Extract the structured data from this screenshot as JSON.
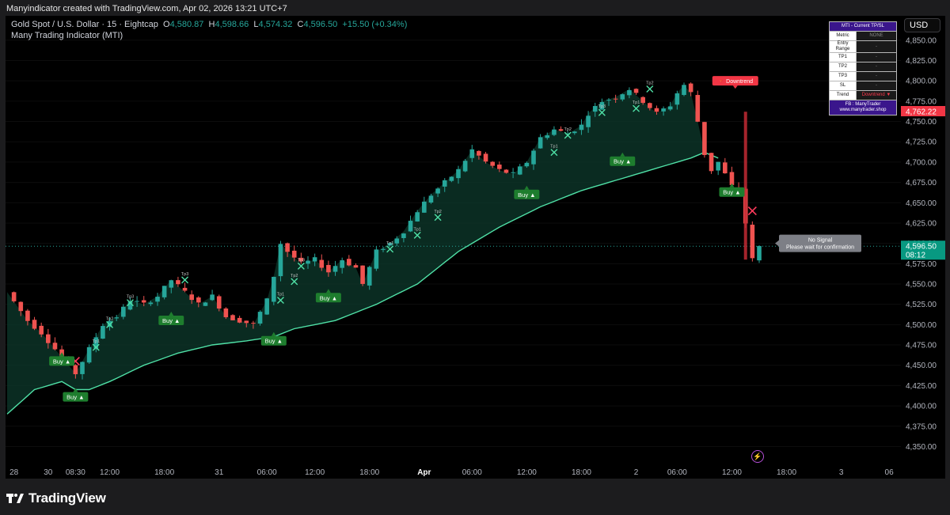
{
  "credit": "Manyindicator created with TradingView.com, Apr 02, 2026 13:21 UTC+7",
  "symbol": "Gold Spot / U.S. Dollar · 15 · Eightcap",
  "ohlc": {
    "o_label": "O",
    "o": "4,580.87",
    "h_label": "H",
    "h": "4,598.66",
    "l_label": "L",
    "l": "4,574.32",
    "c_label": "C",
    "c": "4,596.50",
    "change": "+15.50 (+0.34%)"
  },
  "indicator_name": "Many Trading Indicator (MTI)",
  "currency": "USD",
  "logo_text": "TradingView",
  "colors": {
    "bull": "#26a69a",
    "bear": "#ef5350",
    "ma": "#4fe0a6",
    "buy_bg": "#1e7d2e",
    "sell_red": "#f23645",
    "table_hdr": "#3a168c"
  },
  "mti_table": {
    "title": "MTI - Current TP/SL",
    "rows": [
      {
        "label": "Metric",
        "value": "NONE"
      },
      {
        "label": "Entry Range",
        "value": "-"
      },
      {
        "label": "TP1",
        "value": "-"
      },
      {
        "label": "TP2",
        "value": "-"
      },
      {
        "label": "TP3",
        "value": "-"
      },
      {
        "label": "SL",
        "value": "-"
      },
      {
        "label": "Trend",
        "value": "Downtrend ▼"
      }
    ],
    "footer_line1": "FB : ManyTrader",
    "footer_line2": "www.manytrader.shop"
  },
  "signals": {
    "buy_label": "Buy ▲",
    "downtrend_label": "🔻 Downtrend",
    "no_signal_line1": "No Signal",
    "no_signal_line2": "Please wait for confirmation"
  },
  "chart_data": {
    "type": "candlestick",
    "symbol": "XAUUSD",
    "timeframe": "15",
    "ylim": [
      4330,
      4880
    ],
    "y_ticks": [
      "4,350.00",
      "4,375.00",
      "4,400.00",
      "4,425.00",
      "4,450.00",
      "4,475.00",
      "4,500.00",
      "4,525.00",
      "4,550.00",
      "4,575.00",
      "4,600.00",
      "4,625.00",
      "4,650.00",
      "4,675.00",
      "4,700.00",
      "4,725.00",
      "4,750.00",
      "4,775.00",
      "4,800.00",
      "4,825.00",
      "4,850.00"
    ],
    "y_tick_values": [
      4350,
      4375,
      4400,
      4425,
      4450,
      4475,
      4500,
      4525,
      4550,
      4575,
      4600,
      4625,
      4650,
      4675,
      4700,
      4725,
      4750,
      4775,
      4800,
      4825,
      4850
    ],
    "x_ticks": [
      "28",
      "30",
      "08:30",
      "12:00",
      "18:00",
      "31",
      "06:00",
      "12:00",
      "18:00",
      "Apr",
      "06:00",
      "12:00",
      "18:00",
      "2",
      "06:00",
      "12:00",
      "18:00",
      "3",
      "06"
    ],
    "x_tick_index": [
      1,
      6,
      10,
      15,
      23,
      31,
      38,
      45,
      53,
      61,
      68,
      76,
      84,
      92,
      98,
      106,
      114,
      122,
      129
    ],
    "price_tags": [
      {
        "value": 4762.22,
        "label": "4,762.22",
        "color": "#f23645"
      },
      {
        "value": 4596.5,
        "label": "4,596.50",
        "sub": "08:12",
        "color": "#089981"
      }
    ],
    "last_price": 4596.5,
    "close_path": [
      [
        0,
        4540
      ],
      [
        3,
        4505
      ],
      [
        5,
        4490
      ],
      [
        7,
        4470
      ],
      [
        9,
        4450
      ],
      [
        10,
        4440
      ],
      [
        12,
        4470
      ],
      [
        14,
        4500
      ],
      [
        16,
        4510
      ],
      [
        18,
        4530
      ],
      [
        20,
        4525
      ],
      [
        22,
        4535
      ],
      [
        24,
        4555
      ],
      [
        26,
        4540
      ],
      [
        28,
        4525
      ],
      [
        30,
        4535
      ],
      [
        32,
        4510
      ],
      [
        34,
        4505
      ],
      [
        36,
        4500
      ],
      [
        38,
        4530
      ],
      [
        39,
        4560
      ],
      [
        40,
        4600
      ],
      [
        41,
        4590
      ],
      [
        43,
        4575
      ],
      [
        45,
        4580
      ],
      [
        47,
        4565
      ],
      [
        49,
        4580
      ],
      [
        51,
        4570
      ],
      [
        52,
        4550
      ],
      [
        54,
        4590
      ],
      [
        56,
        4600
      ],
      [
        58,
        4615
      ],
      [
        60,
        4640
      ],
      [
        62,
        4660
      ],
      [
        64,
        4675
      ],
      [
        66,
        4690
      ],
      [
        68,
        4715
      ],
      [
        70,
        4700
      ],
      [
        72,
        4690
      ],
      [
        74,
        4685
      ],
      [
        76,
        4700
      ],
      [
        78,
        4730
      ],
      [
        80,
        4740
      ],
      [
        82,
        4735
      ],
      [
        84,
        4745
      ],
      [
        85,
        4760
      ],
      [
        87,
        4775
      ],
      [
        89,
        4780
      ],
      [
        91,
        4790
      ],
      [
        93,
        4775
      ],
      [
        95,
        4760
      ],
      [
        97,
        4770
      ],
      [
        98,
        4785
      ],
      [
        99,
        4795
      ],
      [
        100,
        4785
      ],
      [
        101,
        4750
      ],
      [
        102,
        4710
      ],
      [
        103,
        4690
      ],
      [
        104,
        4700
      ],
      [
        105,
        4685
      ],
      [
        106,
        4670
      ],
      [
        107,
        4665
      ],
      [
        108,
        4625
      ],
      [
        109,
        4580
      ],
      [
        110,
        4596
      ]
    ],
    "ma_path": [
      [
        0,
        4390
      ],
      [
        4,
        4420
      ],
      [
        8,
        4430
      ],
      [
        10,
        4420
      ],
      [
        12,
        4420
      ],
      [
        15,
        4430
      ],
      [
        20,
        4450
      ],
      [
        25,
        4465
      ],
      [
        30,
        4475
      ],
      [
        35,
        4480
      ],
      [
        39,
        4485
      ],
      [
        42,
        4495
      ],
      [
        48,
        4505
      ],
      [
        54,
        4525
      ],
      [
        60,
        4550
      ],
      [
        66,
        4590
      ],
      [
        72,
        4620
      ],
      [
        78,
        4645
      ],
      [
        84,
        4665
      ],
      [
        90,
        4680
      ],
      [
        96,
        4695
      ],
      [
        100,
        4705
      ],
      [
        102,
        4712
      ],
      [
        104,
        4705
      ]
    ],
    "buy_signals": [
      [
        8,
        4462
      ],
      [
        10,
        4418
      ],
      [
        24,
        4512
      ],
      [
        39,
        4487
      ],
      [
        47,
        4540
      ],
      [
        76,
        4667
      ],
      [
        90,
        4708
      ],
      [
        106,
        4670
      ]
    ],
    "tp_markers": [
      {
        "i": 13,
        "p": 4472,
        "label": "Tp1"
      },
      {
        "i": 15,
        "p": 4500,
        "label": "Tp2"
      },
      {
        "i": 18,
        "p": 4527,
        "label": "Tp3"
      },
      {
        "i": 26,
        "p": 4555,
        "label": "Tp3"
      },
      {
        "i": 40,
        "p": 4530,
        "label": "Tp1"
      },
      {
        "i": 42,
        "p": 4553,
        "label": "Tp2"
      },
      {
        "i": 43,
        "p": 4572,
        "label": "Tp3"
      },
      {
        "i": 56,
        "p": 4593,
        "label": "Tp1"
      },
      {
        "i": 60,
        "p": 4610,
        "label": "Tp1"
      },
      {
        "i": 63,
        "p": 4632,
        "label": "Tp2"
      },
      {
        "i": 80,
        "p": 4712,
        "label": "Tp1"
      },
      {
        "i": 82,
        "p": 4733,
        "label": "Tp2"
      },
      {
        "i": 87,
        "p": 4761,
        "label": "Tp3"
      },
      {
        "i": 92,
        "p": 4766,
        "label": "Tp1"
      },
      {
        "i": 94,
        "p": 4790,
        "label": "Tp2"
      }
    ],
    "sl_markers": [
      [
        10,
        4455
      ],
      [
        109,
        4640
      ]
    ],
    "xlabel": "",
    "ylabel": ""
  }
}
